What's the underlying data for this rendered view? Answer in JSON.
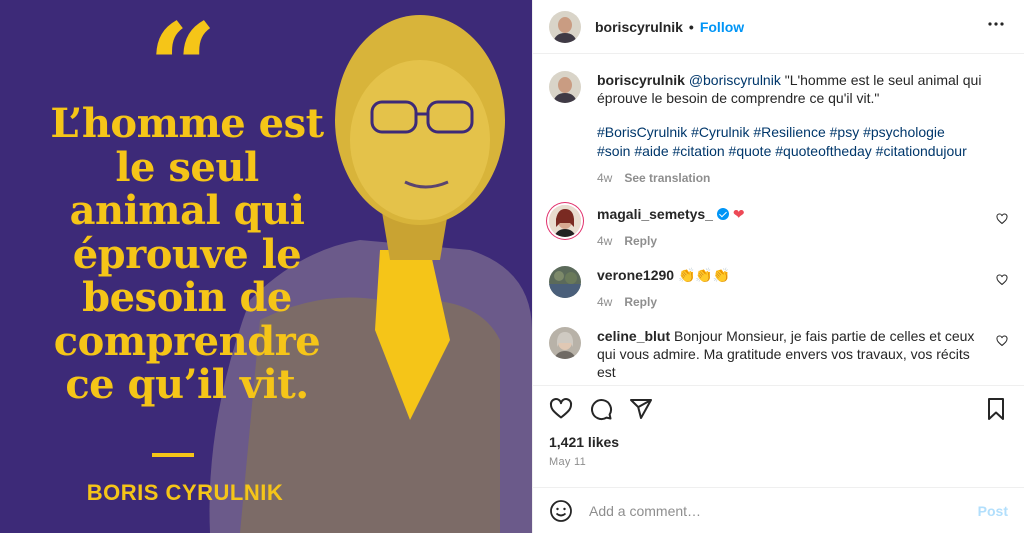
{
  "media": {
    "quote_mark": "“",
    "quote_lines": [
      "L’homme est",
      "le seul",
      "animal qui",
      "éprouve le",
      "besoin de",
      "comprendre",
      "ce qu’il vit."
    ],
    "author": "BORIS CYRULNIK",
    "colors": {
      "background": "#3d2a78",
      "accent": "#f5c518"
    }
  },
  "header": {
    "username": "boriscyrulnik",
    "separator": "•",
    "follow_label": "Follow",
    "more_icon": "more-horizontal-icon"
  },
  "caption": {
    "username": "boriscyrulnik",
    "mention": "@boriscyrulnik",
    "text": "\"L'homme est le seul animal qui éprouve le besoin de comprendre ce qu'il vit.\"",
    "hashtags": "#BorisCyrulnik #Cyrulnik #Resilience #psy #psychologie #soin #aide #citation #quote #quoteoftheday #citationdujour",
    "time": "4w",
    "see_translation": "See translation"
  },
  "comments": [
    {
      "username": "magali_semetys_",
      "text": "",
      "verified": true,
      "emoji": "❤",
      "time": "4w",
      "reply": "Reply"
    },
    {
      "username": "verone1290",
      "text": "",
      "verified": false,
      "emoji": "👏👏👏",
      "time": "4w",
      "reply": "Reply"
    },
    {
      "username": "celine_blut",
      "text": "Bonjour Monsieur, je fais partie de celles et ceux qui vous admire. Ma gratitude envers vos travaux, vos récits est",
      "verified": false,
      "emoji": "",
      "time": "",
      "reply": ""
    }
  ],
  "actions": {
    "like_icon": "heart-icon",
    "comment_icon": "comment-icon",
    "share_icon": "share-icon",
    "save_icon": "bookmark-icon"
  },
  "likes": "1,421 likes",
  "date": "May 11",
  "add_comment": {
    "placeholder": "Add a comment…",
    "post_label": "Post",
    "emoji_icon": "smiley-icon"
  }
}
